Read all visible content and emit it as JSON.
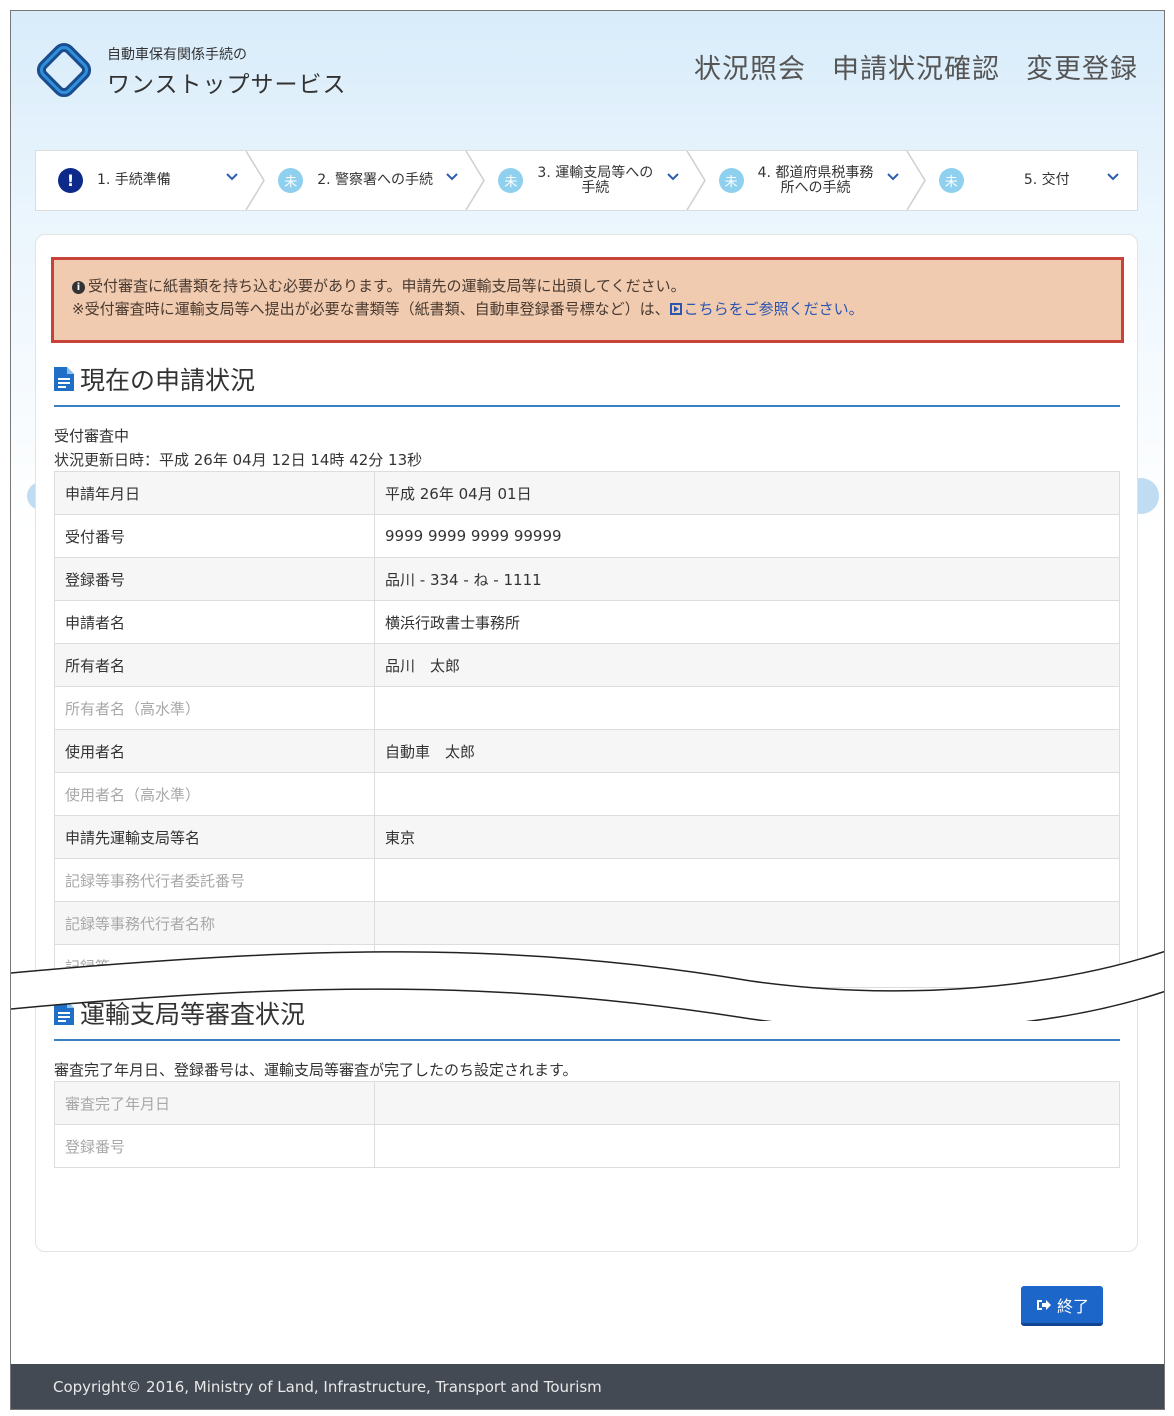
{
  "header": {
    "logo_sub": "自動車保有関係手続の",
    "logo_main": "ワンストップサービス",
    "nav": [
      "状況照会",
      "申請状況確認",
      "変更登録"
    ]
  },
  "steps": [
    {
      "icon": "!",
      "label": "1. 手続準備"
    },
    {
      "icon": "未",
      "label": "2. 警察署への手続"
    },
    {
      "icon": "未",
      "label": "3. 運輸支局等への\n手続"
    },
    {
      "icon": "未",
      "label": "4. 都道府県税事務\n所への手続"
    },
    {
      "icon": "未",
      "label": "5. 交付"
    }
  ],
  "alert": {
    "line1": "受付審査に紙書類を持ち込む必要があります。申請先の運輸支局等に出頭してください。",
    "line2_prefix": "※受付審査時に運輸支局等へ提出が必要な書類等（紙書類、自動車登録番号標など）は、",
    "line2_link": "こちらをご参照ください。"
  },
  "status_section": {
    "title": "現在の申請状況",
    "state": "受付審査中",
    "updated": "状況更新日時：平成 26年 04月 12日 14時 42分 13秒",
    "rows": [
      {
        "key": "申請年月日",
        "value": "平成 26年 04月 01日",
        "dim": false
      },
      {
        "key": "受付番号",
        "value": "9999 9999 9999 99999",
        "dim": false
      },
      {
        "key": "登録番号",
        "value": "品川 - 334 - ね - 1111",
        "dim": false
      },
      {
        "key": "申請者名",
        "value": "横浜行政書士事務所",
        "dim": false
      },
      {
        "key": "所有者名",
        "value": "品川　太郎",
        "dim": false
      },
      {
        "key": "所有者名（高水準）",
        "value": "",
        "dim": true
      },
      {
        "key": "使用者名",
        "value": "自動車　太郎",
        "dim": false
      },
      {
        "key": "使用者名（高水準）",
        "value": "",
        "dim": true
      },
      {
        "key": "申請先運輸支局等名",
        "value": "東京",
        "dim": false
      },
      {
        "key": "記録等事務代行者委託番号",
        "value": "",
        "dim": true
      },
      {
        "key": "記録等事務代行者名称",
        "value": "",
        "dim": true
      },
      {
        "key": "記録等",
        "value": "",
        "dim": true
      }
    ]
  },
  "review_section": {
    "title": "運輸支局等審査状況",
    "note": "審査完了年月日、登録番号は、運輸支局等審査が完了したのち設定されます。",
    "rows": [
      {
        "key": "審査完了年月日",
        "value": "",
        "dim": true
      },
      {
        "key": "登録番号",
        "value": "",
        "dim": true
      }
    ]
  },
  "buttons": {
    "exit": "終了"
  },
  "footer": {
    "copyright": "Copyright© 2016, Ministry of Land, Infrastructure, Transport and Tourism"
  },
  "colors": {
    "accent": "#1d66c9",
    "alert_bg": "#f0cbb0",
    "alert_border": "#c9423a",
    "footer_bg": "#444a54",
    "step_todo": "#8fd0ee",
    "step_alert": "#0d2a8a"
  },
  "icons": {
    "logo": "diamond-logo-icon",
    "step_alert": "exclamation-icon",
    "step_todo": "pending-icon",
    "chevron": "chevron-down-icon",
    "doc": "document-icon",
    "info": "info-icon",
    "link": "external-link-icon",
    "exit": "sign-out-icon"
  }
}
